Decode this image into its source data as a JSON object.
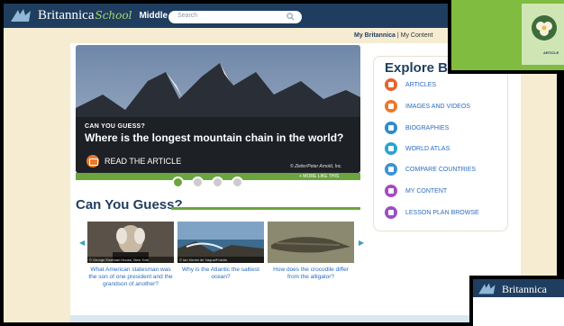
{
  "header": {
    "brand": "Britannica",
    "school": "School",
    "level": "Middle",
    "search_placeholder": "Search"
  },
  "usernav": {
    "my_britannica": "My Britannica",
    "separator": "|",
    "my_content": "My Content"
  },
  "hero": {
    "kicker": "CAN YOU GUESS?",
    "title": "Where is the longest mountain chain in the world?",
    "read_label": "READ THE ARTICLE",
    "credit": "© Ziefer/Peter Arnold, Inc.",
    "more_link": "+ MORE LIKE THIS",
    "carousel_slides": 4,
    "active_slide": 1
  },
  "can_you_guess": {
    "heading": "Can You Guess?",
    "items": [
      {
        "caption": "© George Eastman House, New York",
        "question": "What American statesman was the son of one president and the grandson of another?"
      },
      {
        "caption": "© Ian Vorsin de Vaqua/Fotolia",
        "question": "Why is the Atlantic the saltiest ocean?"
      },
      {
        "caption": "",
        "question": "How does the crocodile differ from the alligator?"
      }
    ]
  },
  "explore": {
    "title": "Explore Bri",
    "items": [
      {
        "label": "ARTICLES",
        "icon": "article-icon",
        "color": "#e8632c"
      },
      {
        "label": "IMAGES AND VIDEOS",
        "icon": "media-icon",
        "color": "#ea7a2a"
      },
      {
        "label": "BIOGRAPHIES",
        "icon": "biography-icon",
        "color": "#2f8ad0"
      },
      {
        "label": "WORLD ATLAS",
        "icon": "globe-icon",
        "color": "#2aa3cf"
      },
      {
        "label": "COMPARE COUNTRIES",
        "icon": "chart-icon",
        "color": "#3b93d6"
      },
      {
        "label": "MY CONTENT",
        "icon": "my-content-icon",
        "color": "#a64bc4"
      },
      {
        "label": "LESSON PLAN BROWSE",
        "icon": "lesson-plan-icon",
        "color": "#9b4fc2"
      }
    ]
  },
  "popup_top": {
    "label": "ARTICLE"
  },
  "popup_bottom": {
    "brand": "Britannica"
  },
  "colors": {
    "navy": "#1f3d5f",
    "green": "#6ba53e",
    "link": "#2a6cc0",
    "page_bg": "#f5ecd2"
  }
}
